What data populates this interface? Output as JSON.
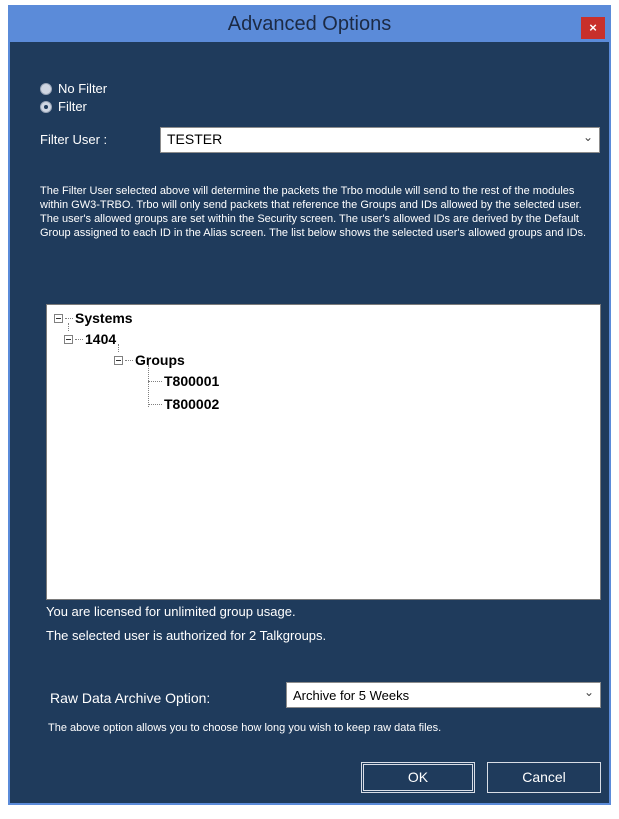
{
  "window": {
    "title": "Advanced Options",
    "close_glyph": "×"
  },
  "filter": {
    "options": [
      "No Filter",
      "Filter"
    ],
    "selected": "Filter",
    "user_label": "Filter User :",
    "user_value": "TESTER"
  },
  "description": "The Filter User selected above will determine the packets the Trbo module will send to the rest of the modules within GW3-TRBO.  Trbo will only send packets that reference the Groups and IDs allowed by the selected user.  The user's allowed groups are set within the Security screen.  The user's allowed IDs are derived by the Default Group assigned to each ID in the Alias screen.  The list below shows the selected user's allowed groups and IDs.",
  "tree": {
    "root": "Systems",
    "system": "1404",
    "groups_label": "Groups",
    "groups": [
      "T800001",
      "T800002"
    ]
  },
  "status": {
    "license": "You are licensed for unlimited group usage.",
    "authorized": "The selected user is authorized for 2 Talkgroups."
  },
  "archive": {
    "label": "Raw Data Archive Option:",
    "value": "Archive for 5 Weeks",
    "note": "The above option allows you to choose how long you wish to keep raw data files."
  },
  "buttons": {
    "ok": "OK",
    "cancel": "Cancel"
  },
  "colors": {
    "titlebar": "#5b8bd9",
    "client": "#1f3b5c",
    "close": "#c8302b"
  }
}
